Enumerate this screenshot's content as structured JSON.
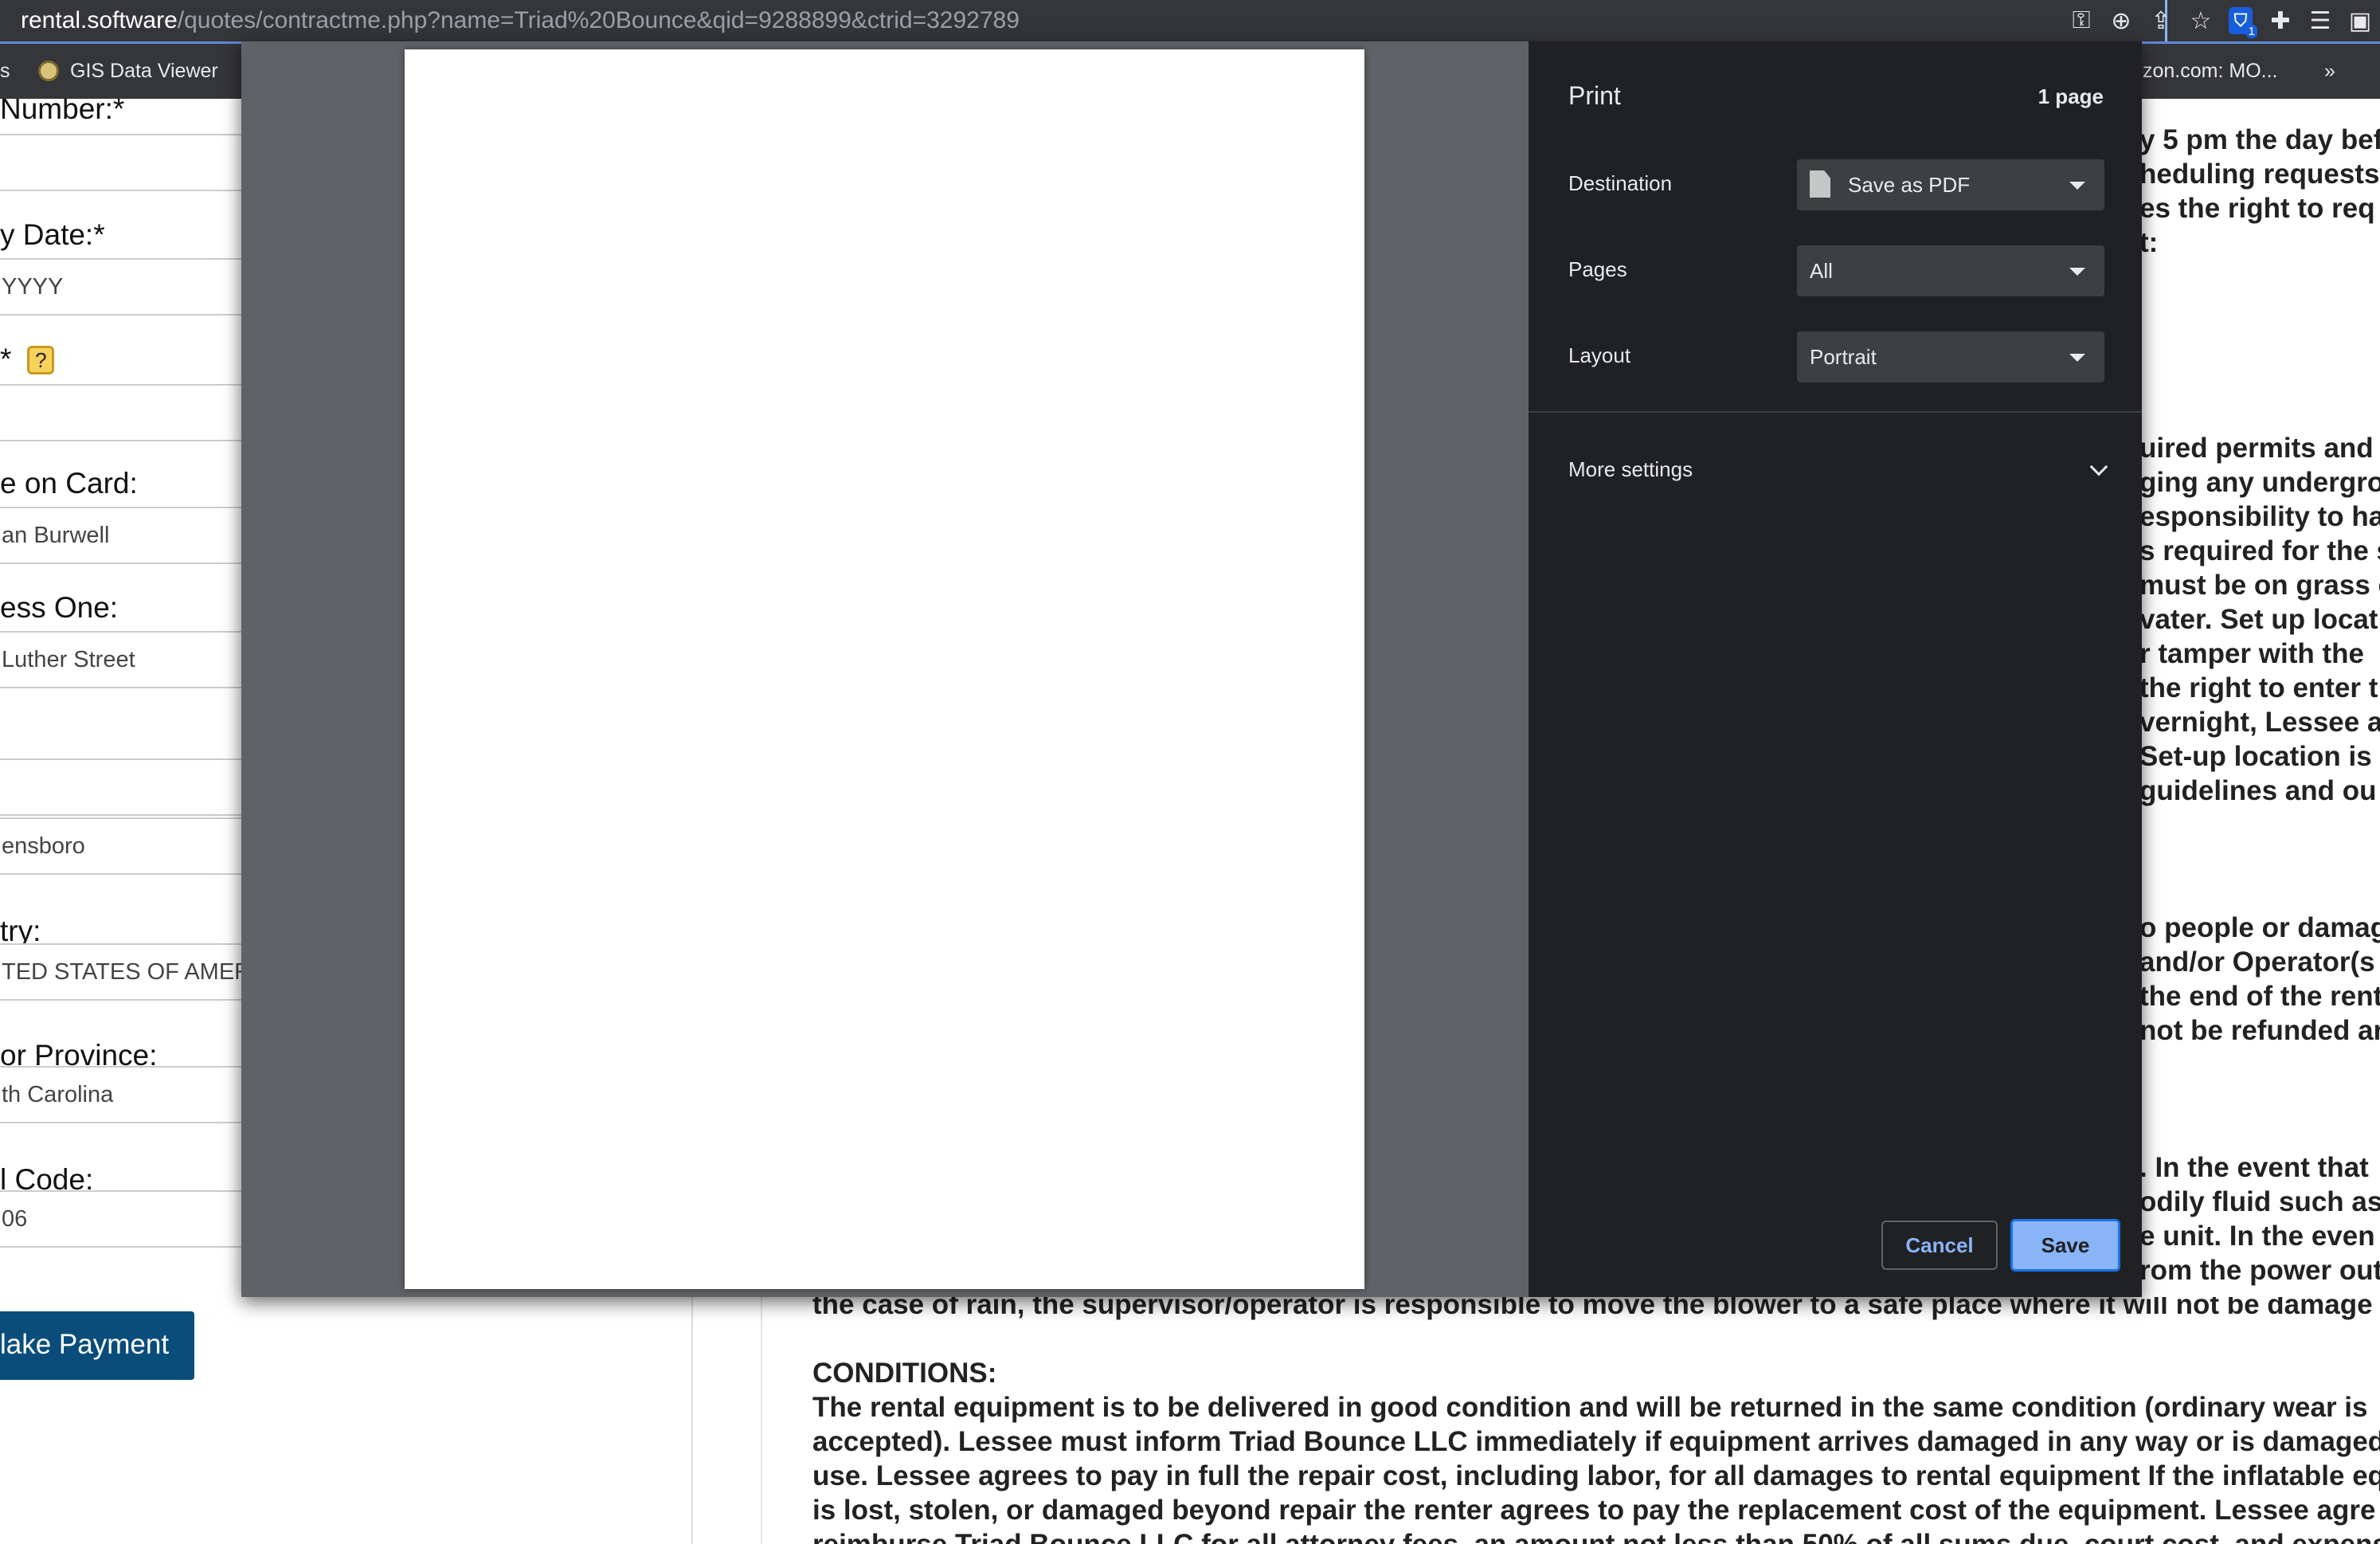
{
  "browser": {
    "url_host": "rental.software",
    "url_path": "/quotes/contractme.php?name=Triad%20Bounce&qid=9288899&ctrid=3292789",
    "bookmarks": {
      "left_fragment": "s",
      "gis": "GIS Data Viewer",
      "right_fragment": "zon.com: MO...",
      "overflow": "»"
    }
  },
  "form": {
    "fields": [
      {
        "label": "Number:*",
        "value": ""
      },
      {
        "label": "y Date:*",
        "value": "YYYY"
      },
      {
        "label": "*",
        "value": ""
      },
      {
        "label": "e on Card:",
        "value": "an  Burwell"
      },
      {
        "label": "ess One:",
        "value": "Luther Street"
      },
      {
        "label": "",
        "value": ""
      },
      {
        "label": "",
        "value": "ensboro"
      },
      {
        "label": "try:",
        "value": "TED STATES OF AMER"
      },
      {
        "label": " or Province:",
        "value": "th Carolina"
      },
      {
        "label": "l Code:",
        "value": "06"
      }
    ],
    "help_icon": "?",
    "pay_button": "lake Payment"
  },
  "right_text": [
    "y 5 pm the day bef",
    "heduling requests a",
    "es the right to req",
    "t:",
    "uired permits and",
    "ging any undergrou",
    "esponsibility to ha",
    "s required for the s",
    "must be on grass o",
    "vater. Set up locati",
    "r tamper with the",
    "the right to enter t",
    "vernight, Lessee a",
    "Set-up location is",
    "guidelines and ou",
    "o people or damag",
    "and/or Operator(s",
    "the end of the rent",
    "not be refunded ar",
    ". In the event that",
    "odily fluid such as b",
    "e unit. In the even",
    "rom the power out"
  ],
  "contract_text": [
    "the case of rain, the supervisor/operator is responsible to move the blower to a safe place where it will not be damage",
    "",
    "CONDITIONS:",
    "The rental equipment is to be delivered in good condition and will be returned in the same condition (ordinary wear is",
    "accepted). Lessee must inform Triad Bounce LLC immediately if equipment arrives damaged in any way or is damaged",
    "use. Lessee agrees to pay in full the repair cost, including labor, for all damages to rental equipment If the inflatable eq",
    "is lost, stolen, or damaged beyond repair the renter agrees to pay the replacement cost of the equipment. Lessee agre",
    "reimburse Triad Bounce LLC for all attorney fees, an amount not less than 50% of all sums due, court cost, and expense"
  ],
  "print_dialog": {
    "title": "Print",
    "page_count": "1 page",
    "destination_label": "Destination",
    "destination_value": "Save as PDF",
    "pages_label": "Pages",
    "pages_value": "All",
    "layout_label": "Layout",
    "layout_value": "Portrait",
    "more_settings": "More settings",
    "cancel": "Cancel",
    "save": "Save"
  },
  "colors": {
    "dialog_bg": "#202124",
    "accent": "#8ab4f8",
    "pay_button": "#0a4d7b"
  }
}
